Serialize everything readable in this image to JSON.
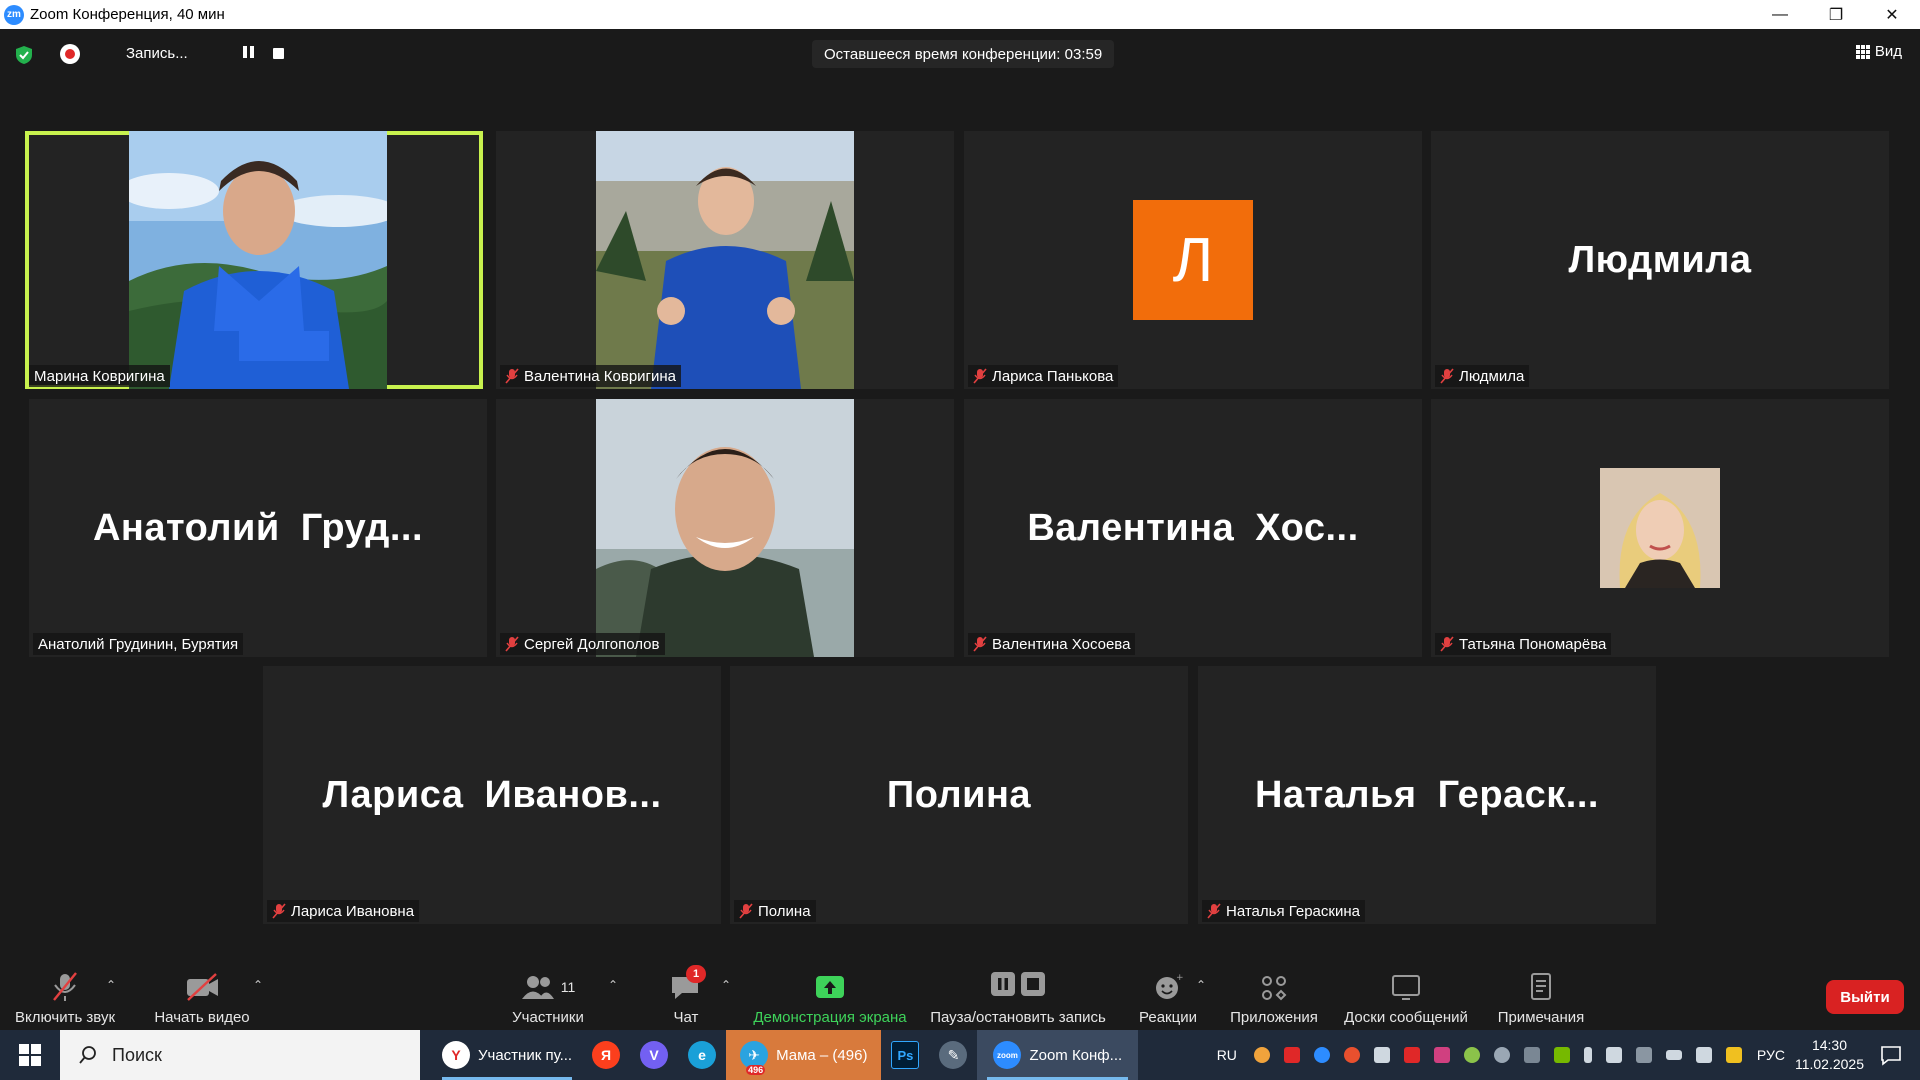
{
  "window": {
    "title": "Zoom Конференция, 40 мин",
    "app_icon_text": "zm",
    "controls": [
      "—",
      "❐",
      "✕"
    ]
  },
  "topbar": {
    "recording_label": "Запись...",
    "timer_text": "Оставшееся время конференции: 03:59",
    "view_label": "Вид"
  },
  "tiles": [
    {
      "display_name": "",
      "tag_name": "Марина Ковригина",
      "muted": false,
      "active": true,
      "kind": "photo"
    },
    {
      "display_name": "",
      "tag_name": "Валентина Ковригина",
      "muted": true,
      "active": false,
      "kind": "photo"
    },
    {
      "display_name": "",
      "tag_name": "Лариса Панькова",
      "muted": true,
      "active": false,
      "kind": "avatar",
      "avatar_letter": "Л"
    },
    {
      "display_name": "Людмила",
      "tag_name": "Людмила",
      "muted": true,
      "active": false,
      "kind": "name"
    },
    {
      "display_name": "Анатолий  Груд...",
      "tag_name": "Анатолий Грудинин, Бурятия",
      "muted": false,
      "active": false,
      "kind": "name"
    },
    {
      "display_name": "",
      "tag_name": "Сергей Долгополов",
      "muted": true,
      "active": false,
      "kind": "photo"
    },
    {
      "display_name": "Валентина  Хос...",
      "tag_name": "Валентина Хосоева",
      "muted": true,
      "active": false,
      "kind": "name"
    },
    {
      "display_name": "",
      "tag_name": "Татьяна Пономарёва",
      "muted": true,
      "active": false,
      "kind": "small-photo"
    },
    {
      "display_name": "Лариса  Иванов...",
      "tag_name": "Лариса Ивановна",
      "muted": true,
      "active": false,
      "kind": "name"
    },
    {
      "display_name": "Полина",
      "tag_name": "Полина",
      "muted": true,
      "active": false,
      "kind": "name"
    },
    {
      "display_name": "Наталья  Гераск...",
      "tag_name": "Наталья Гераскина",
      "muted": true,
      "active": false,
      "kind": "name"
    }
  ],
  "toolbar": {
    "unmute_label": "Включить звук",
    "video_label": "Начать видео",
    "participants_label": "Участники",
    "participants_count": "11",
    "chat_label": "Чат",
    "chat_badge": "1",
    "share_label": "Демонстрация экрана",
    "record_label": "Пауза/остановить запись",
    "reactions_label": "Реакции",
    "apps_label": "Приложения",
    "whiteboards_label": "Доски сообщений",
    "notes_label": "Примечания",
    "leave_label": "Выйти"
  },
  "taskbar": {
    "search_placeholder": "Поиск",
    "apps": [
      {
        "label": "Участник пу...",
        "icon_text": "Y"
      },
      {
        "label": "",
        "icon_text": "Я"
      },
      {
        "label": "",
        "icon_text": "V"
      },
      {
        "label": "",
        "icon_text": "e"
      },
      {
        "label": "Мама – (496)",
        "icon_text": "✈",
        "badge": "496"
      },
      {
        "label": "",
        "icon_text": "Ps"
      },
      {
        "label": "",
        "icon_text": "✎"
      },
      {
        "label": "Zoom Конф...",
        "icon_text": "zoom"
      }
    ],
    "lang_short": "RU",
    "lang": "РУС",
    "time": "14:30",
    "date": "11.02.2025"
  },
  "colors": {
    "active_speaker": "#c8f24e",
    "avatar_orange": "#f26d0b",
    "leave_red": "#d92222",
    "share_green": "#3ed35a"
  }
}
